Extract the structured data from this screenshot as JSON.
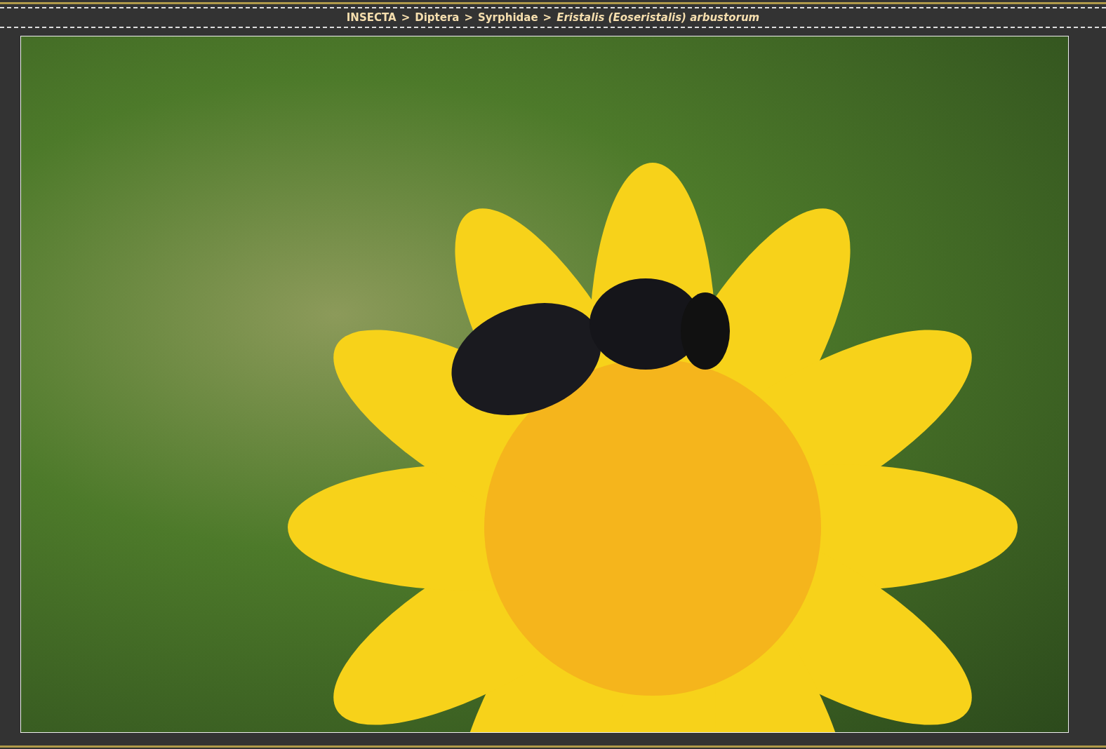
{
  "breadcrumb": {
    "separator": ">",
    "items": [
      {
        "label": "INSECTA",
        "italic": false
      },
      {
        "label": "Diptera",
        "italic": false
      },
      {
        "label": "Syrphidae",
        "italic": false
      },
      {
        "label": "Eristalis (Eoseristalis) arbustorum",
        "italic": true
      }
    ]
  }
}
